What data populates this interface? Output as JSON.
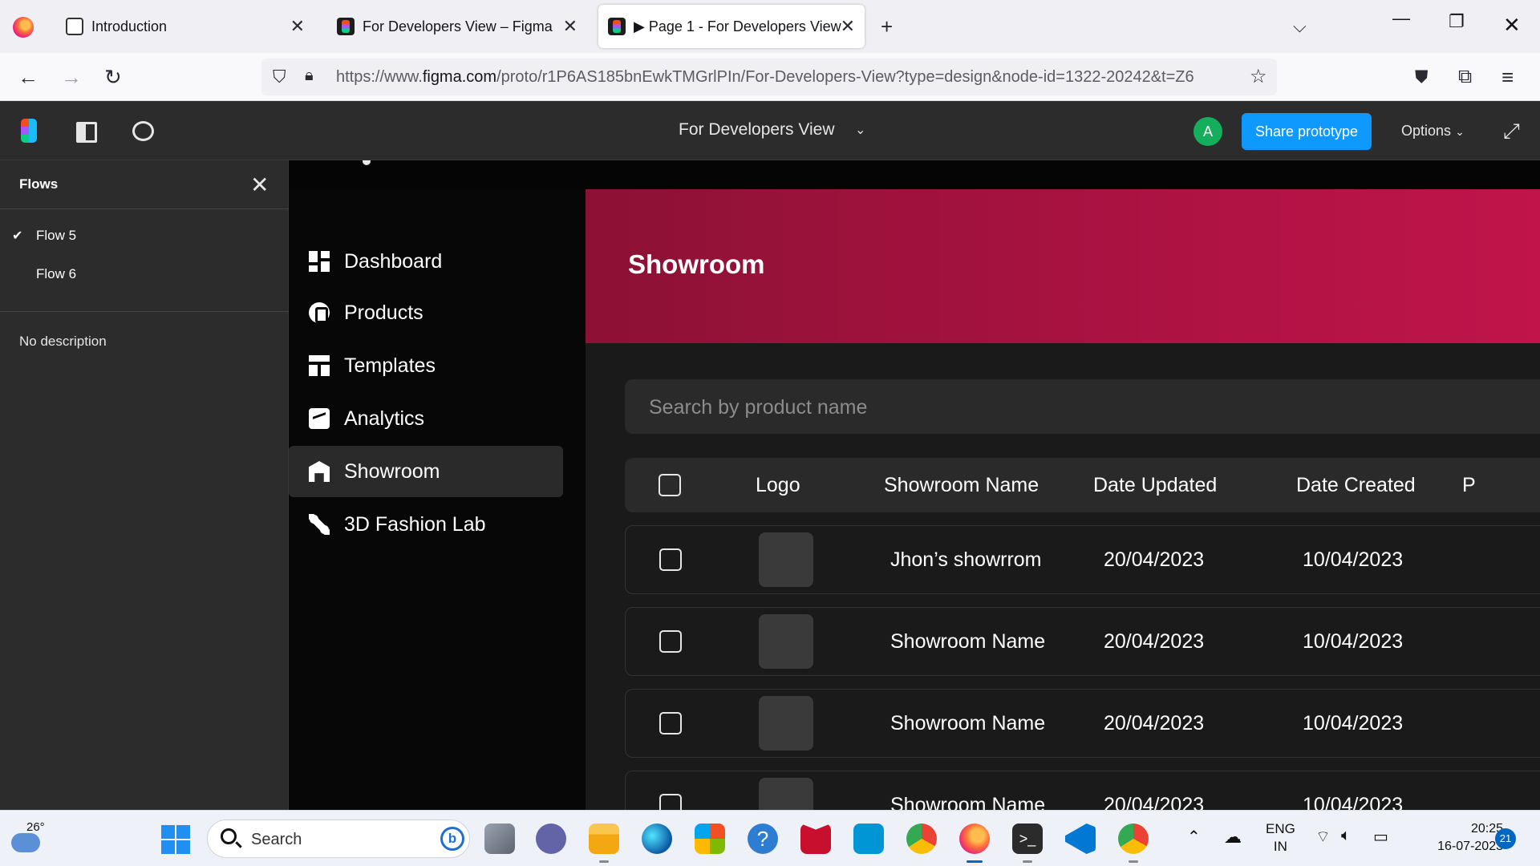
{
  "browser": {
    "tabs": [
      {
        "title": "Introduction",
        "active": false
      },
      {
        "title": "For Developers View – Figma",
        "active": false
      },
      {
        "title": "▶ Page 1 - For Developers View",
        "active": true
      }
    ],
    "url_prefix": "https://www.",
    "url_domain": "figma.com",
    "url_rest": "/proto/r1P6AS185bnEwkTMGrlPIn/For-Developers-View?type=design&node-id=1322-20242&t=Z6"
  },
  "figma": {
    "file_title": "For Developers View",
    "avatar_initial": "A",
    "avatar_color": "#14ae5c",
    "share_label": "Share prototype",
    "options_label": "Options"
  },
  "flows_panel": {
    "title": "Flows",
    "items": [
      {
        "label": "Flow 5",
        "selected": true
      },
      {
        "label": "Flow 6",
        "selected": false
      }
    ],
    "description": "No description"
  },
  "app": {
    "sidebar": [
      {
        "label": "Dashboard",
        "icon": "dashboard-icon"
      },
      {
        "label": "Products",
        "icon": "products-icon"
      },
      {
        "label": "Templates",
        "icon": "templates-icon"
      },
      {
        "label": "Analytics",
        "icon": "analytics-icon"
      },
      {
        "label": "Showroom",
        "icon": "showroom-icon",
        "active": true
      },
      {
        "label": "3D Fashion Lab",
        "icon": "fashion-lab-icon"
      }
    ],
    "banner_title": "Showroom",
    "banner_color": "#a51240",
    "search_placeholder": "Search by product name",
    "table": {
      "columns": [
        "Logo",
        "Showroom Name",
        "Date Updated",
        "Date Created",
        "P"
      ],
      "rows": [
        {
          "name": "Jhon’s showrrom",
          "updated": "20/04/2023",
          "created": "10/04/2023"
        },
        {
          "name": "Showroom Name",
          "updated": "20/04/2023",
          "created": "10/04/2023"
        },
        {
          "name": "Showroom Name",
          "updated": "20/04/2023",
          "created": "10/04/2023"
        },
        {
          "name": "Showroom Name",
          "updated": "20/04/2023",
          "created": "10/04/2023"
        }
      ]
    }
  },
  "taskbar": {
    "temperature": "26°",
    "search_label": "Search",
    "lang_line1": "ENG",
    "lang_line2": "IN",
    "time": "20:25",
    "date": "16-07-2023",
    "notification_count": "21"
  }
}
